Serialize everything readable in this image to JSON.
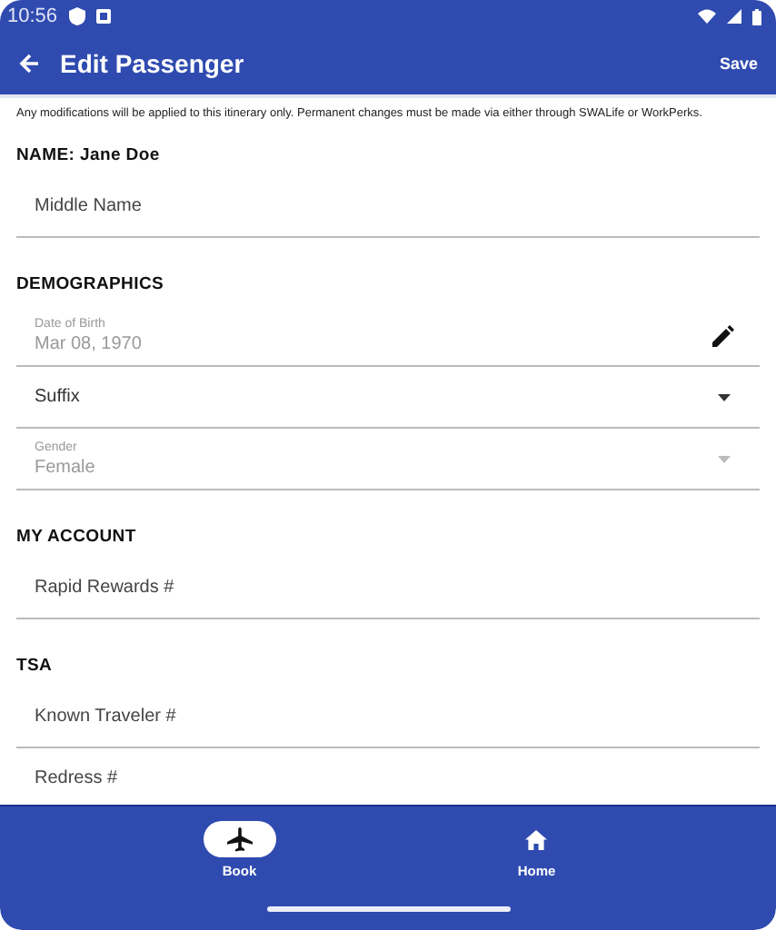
{
  "status_bar": {
    "time": "10:56"
  },
  "app_bar": {
    "title": "Edit Passenger",
    "action": "Save"
  },
  "notice": "Any modifications will be applied to this itinerary only. Permanent changes must be made via either through SWALife or WorkPerks.",
  "sections": [
    {
      "heading": "NAME: Jane Doe",
      "fields": [
        {
          "kind": "text",
          "placeholder": "Middle Name"
        }
      ]
    },
    {
      "heading": "DEMOGRAPHICS",
      "fields": [
        {
          "kind": "date",
          "label": "Date of Birth",
          "value": "Mar 08, 1970",
          "disabled": true
        },
        {
          "kind": "select",
          "placeholder": "Suffix",
          "disabled": false
        },
        {
          "kind": "select",
          "label": "Gender",
          "value": "Female",
          "disabled": true
        }
      ]
    },
    {
      "heading": "MY ACCOUNT",
      "fields": [
        {
          "kind": "text",
          "placeholder": "Rapid Rewards #"
        }
      ]
    },
    {
      "heading": "TSA",
      "fields": [
        {
          "kind": "text",
          "placeholder": "Known Traveler #"
        },
        {
          "kind": "text",
          "placeholder": "Redress #"
        }
      ]
    }
  ],
  "nav": [
    {
      "label": "Book",
      "kind": "book",
      "selected": true
    },
    {
      "label": "Home",
      "kind": "home",
      "selected": false
    }
  ]
}
